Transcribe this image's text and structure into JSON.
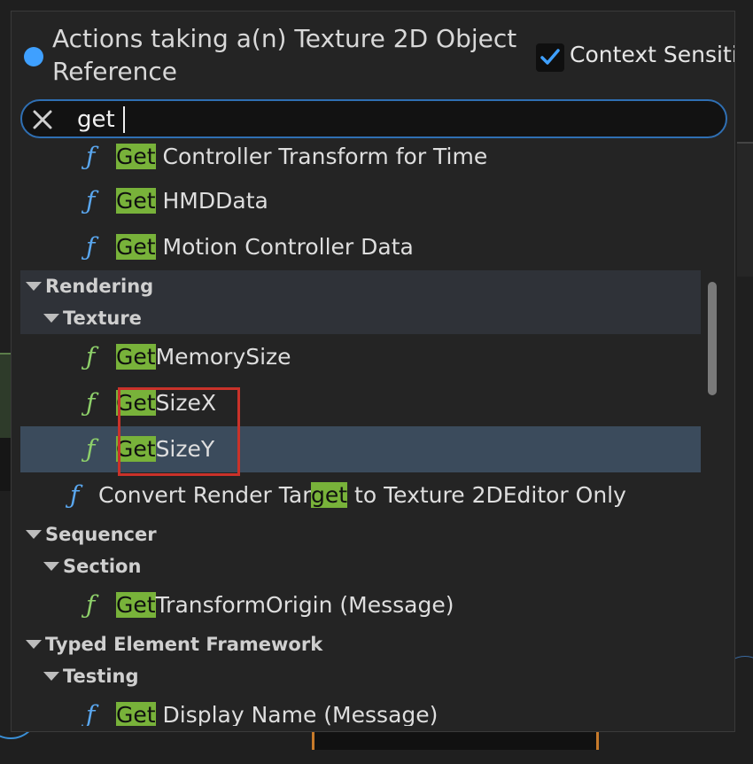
{
  "popup": {
    "title": "Actions taking a(n) Texture 2D Object Reference",
    "context_sensitive_label": "Context Sensitive",
    "context_sensitive_checked": true,
    "search_value": "get"
  },
  "rows": [
    {
      "kind": "action",
      "icon": "function-icon",
      "pre": "",
      "match": "Get",
      "post": " Controller Transform for Time"
    },
    {
      "kind": "action",
      "icon": "function-icon",
      "pre": "",
      "match": "Get",
      "post": " HMDData"
    },
    {
      "kind": "action",
      "icon": "function-icon",
      "pre": "",
      "match": "Get",
      "post": " Motion Controller Data"
    },
    {
      "kind": "category",
      "label": "Rendering"
    },
    {
      "kind": "category",
      "label": "Texture"
    },
    {
      "kind": "action",
      "icon": "pure-function-icon",
      "pre": "",
      "match": "Get",
      "post": "MemorySize"
    },
    {
      "kind": "action",
      "icon": "pure-function-icon",
      "pre": "",
      "match": "Get",
      "post": "SizeX"
    },
    {
      "kind": "action",
      "icon": "pure-function-icon",
      "pre": "",
      "match": "Get",
      "post": "SizeY",
      "selected": true
    },
    {
      "kind": "action",
      "icon": "function-icon",
      "pre": "Convert Render Tar",
      "match": "get",
      "post": " to Texture 2DEditor Only"
    },
    {
      "kind": "category",
      "label": "Sequencer"
    },
    {
      "kind": "category",
      "label": "Section"
    },
    {
      "kind": "action",
      "icon": "pure-function-icon",
      "pre": "",
      "match": "Get",
      "post": "TransformOrigin (Message)"
    },
    {
      "kind": "category",
      "label": "Typed Element Framework"
    },
    {
      "kind": "category",
      "label": "Testing"
    },
    {
      "kind": "action",
      "icon": "function-icon",
      "pre": "",
      "match": "Get",
      "post": " Display Name (Message)"
    }
  ],
  "colors": {
    "accent": "#3fa0ff",
    "search_border": "#2f6fb3",
    "highlight": "#78b23a",
    "selected_row": "#3b4b5c",
    "annotation": "#c9322a"
  }
}
